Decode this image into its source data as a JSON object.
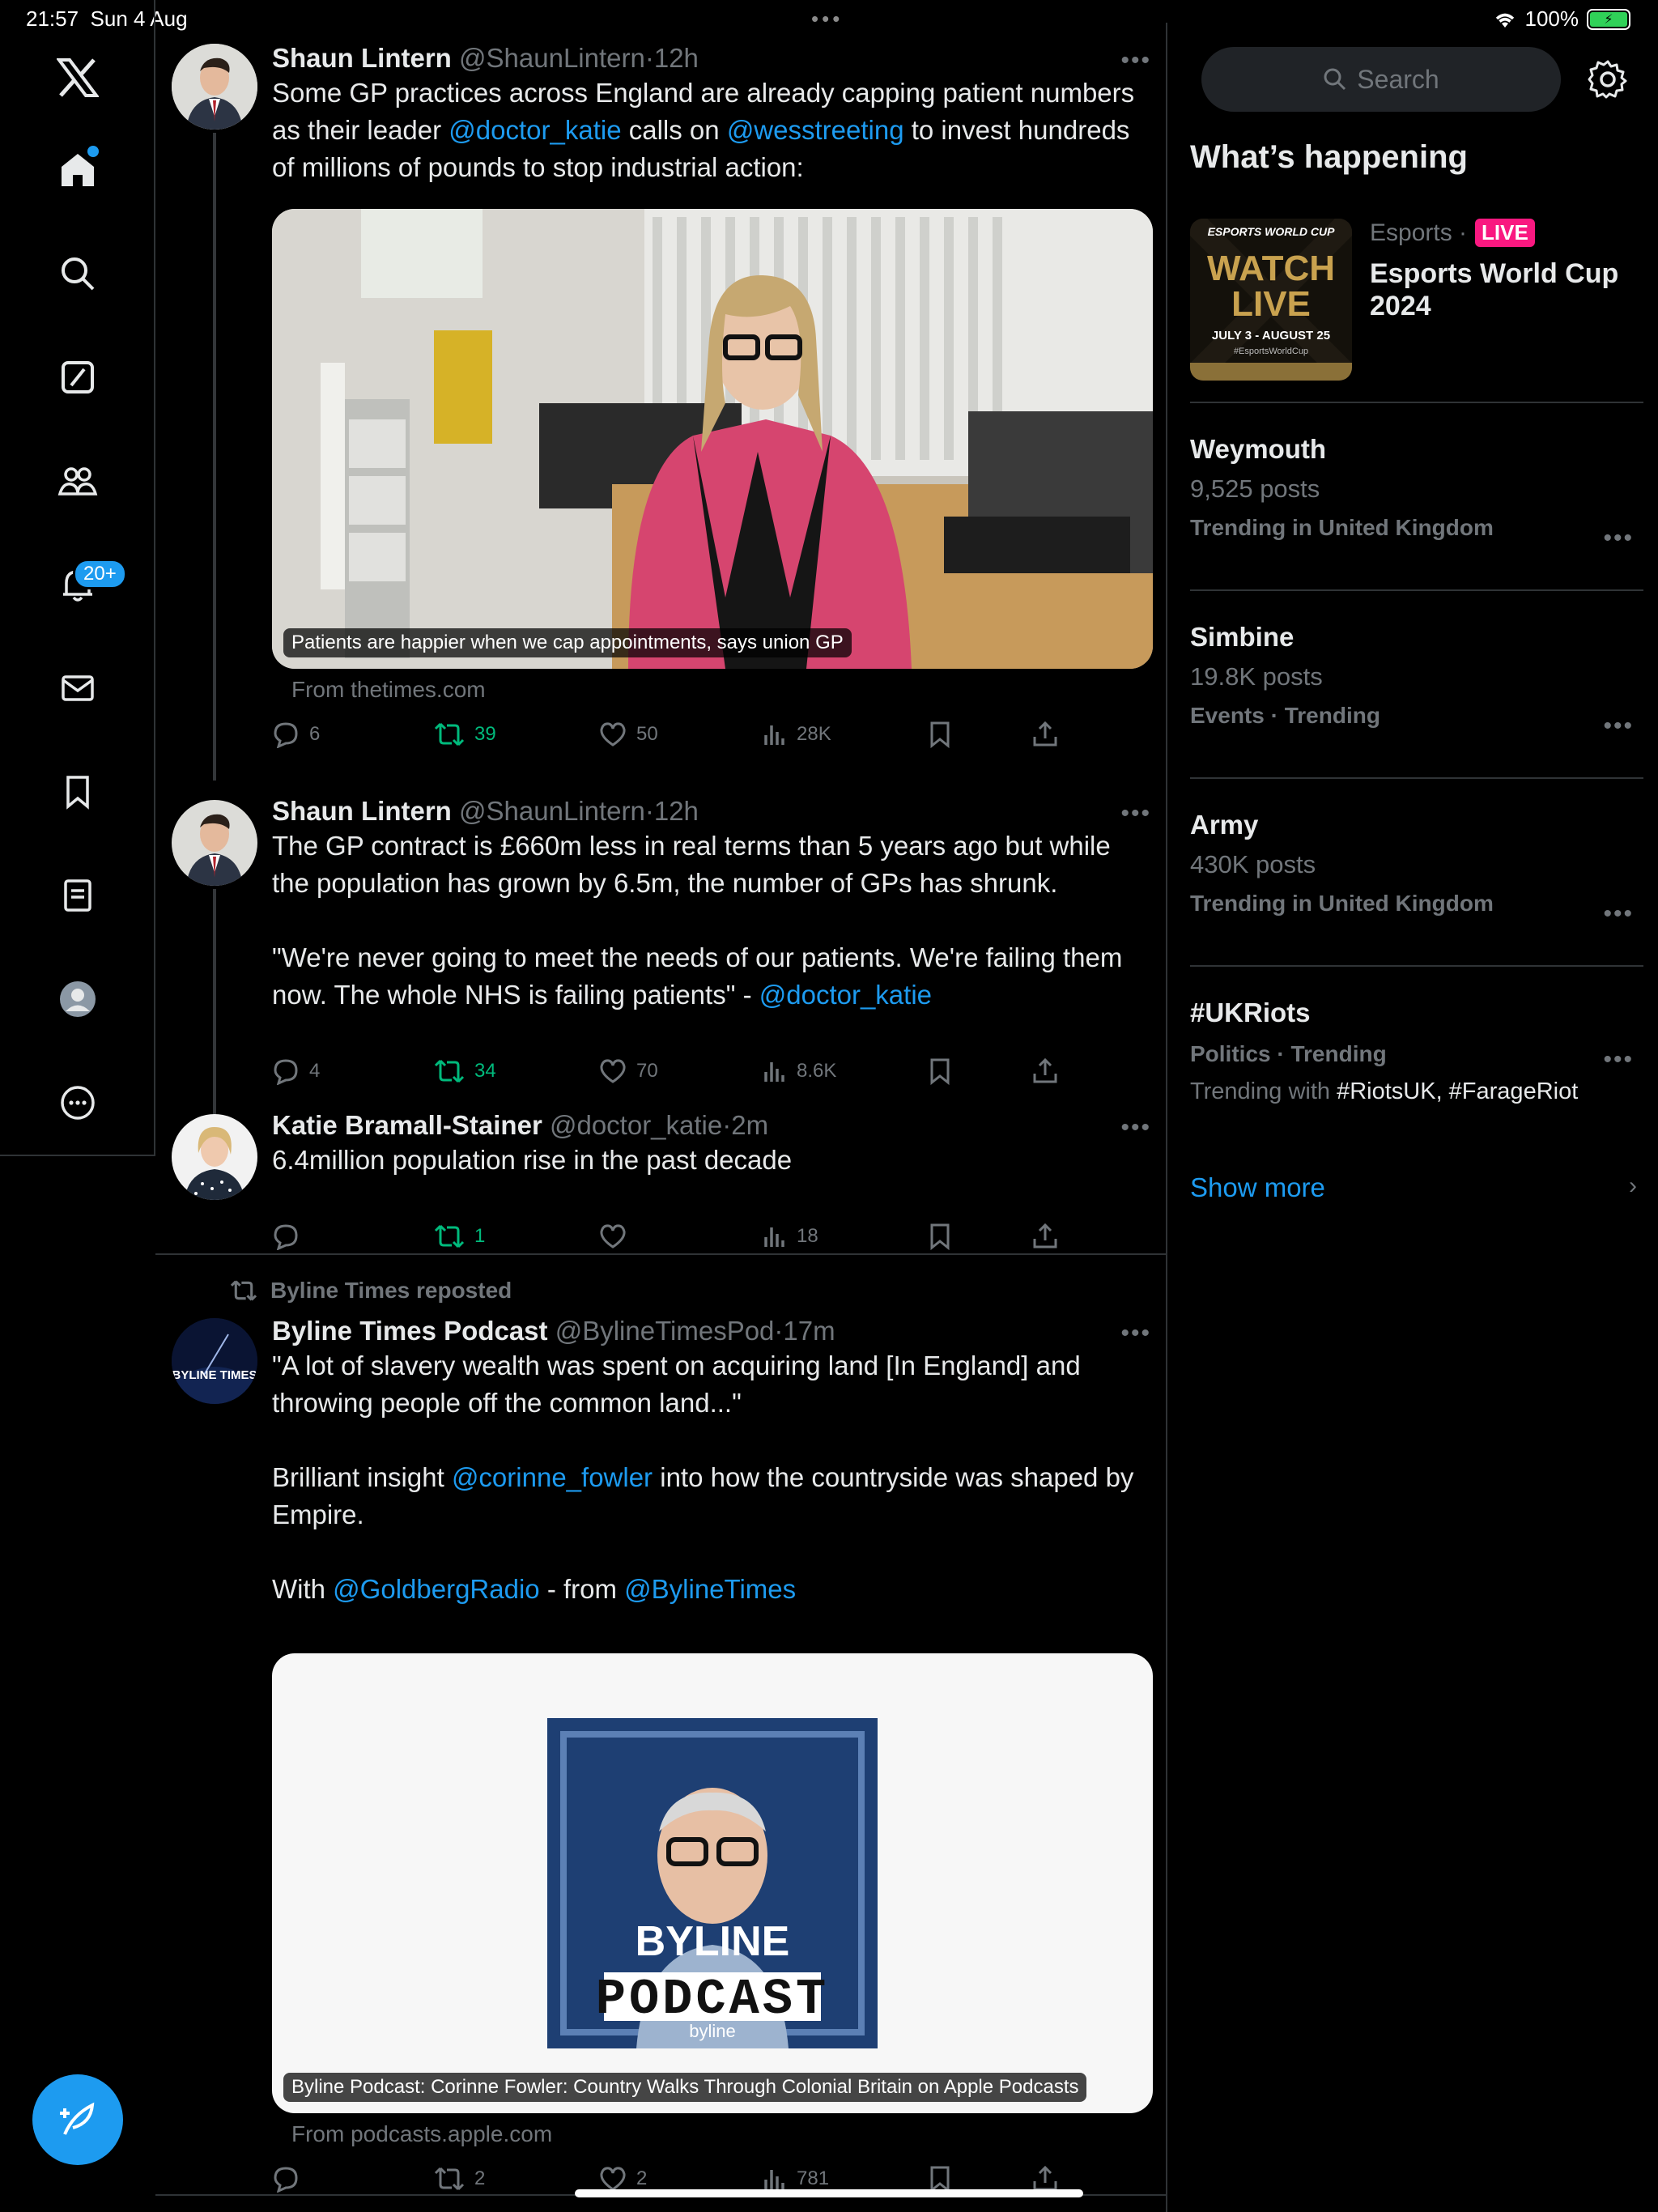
{
  "status_bar": {
    "time": "21:57",
    "date": "Sun 4 Aug",
    "battery": "100%"
  },
  "nav": {
    "notifications_badge": "20+",
    "items": [
      "x-logo-icon",
      "home-icon",
      "search-icon",
      "grok-icon",
      "communities-icon",
      "notifications-icon",
      "messages-icon",
      "bookmarks-icon",
      "lists-icon",
      "profile-icon",
      "more-icon"
    ]
  },
  "tweets": [
    {
      "name": "Shaun Lintern",
      "handle": "@ShaunLintern",
      "sep": "·",
      "time": "12h",
      "text_parts": [
        "Some GP practices across England are already capping patient numbers as their leader ",
        "@doctor_katie",
        " calls on ",
        "@wesstreeting",
        " to invest hundreds of millions of pounds to stop industrial action:"
      ],
      "card_caption": "Patients are happier when we cap appointments, says union GP",
      "card_from": "From thetimes.com",
      "replies": "6",
      "reposts": "39",
      "likes": "50",
      "views": "28K"
    },
    {
      "name": "Shaun Lintern",
      "handle": "@ShaunLintern",
      "sep": "·",
      "time": "12h",
      "text_parts": [
        "The GP contract is £660m less in real terms than 5 years ago but while the population has grown by 6.5m, the number of GPs has shrunk.\n\n\"We're never going to meet the needs of our patients. We're failing them now. The whole NHS is failing patients\" - ",
        "@doctor_katie"
      ],
      "replies": "4",
      "reposts": "34",
      "likes": "70",
      "views": "8.6K"
    },
    {
      "name": "Katie Bramall-Stainer",
      "handle": "@doctor_katie",
      "sep": "·",
      "time": "2m",
      "text": "6.4million population rise in the past decade",
      "replies": "",
      "reposts": "1",
      "likes": "",
      "views": "18"
    },
    {
      "reposted_by": "Byline Times reposted",
      "name": "Byline Times Podcast",
      "handle": "@BylineTimesPod",
      "sep": "·",
      "time": "17m",
      "text_parts": [
        "\"A lot of slavery wealth was spent on acquiring land [In England] and throwing people off the common land...\"\n\nBrilliant insight ",
        "@corinne_fowler",
        " into how the countryside was shaped by Empire.\n\nWith ",
        "@GoldbergRadio",
        " - from ",
        "@BylineTimes"
      ],
      "avatar_text": "BYLINE TIMES",
      "cover_title_1": "BYLINE",
      "cover_title_2": "PODCAST",
      "cover_brand": "byline",
      "card_caption": "Byline Podcast: Corinne Fowler: Country Walks Through Colonial Britain on Apple Podcasts",
      "card_from": "From podcasts.apple.com",
      "replies": "",
      "reposts": "2",
      "likes": "2",
      "views": "781"
    }
  ],
  "sidebar": {
    "search_placeholder": "Search",
    "title": "What’s happening",
    "esports": {
      "category": "Esports ·",
      "live": "LIVE",
      "title": "Esports World Cup 2024",
      "img_top": "ESPORTS WORLD CUP",
      "img_main1": "WATCH",
      "img_main2": "LIVE",
      "img_dates": "JULY 3 - AUGUST 25",
      "img_tag": "#EsportsWorldCup"
    },
    "trends": [
      {
        "name": "Weymouth",
        "posts": "9,525 posts",
        "context": "Trending in United Kingdom"
      },
      {
        "name": "Simbine",
        "posts": "19.8K posts",
        "context": "Events · Trending"
      },
      {
        "name": "Army",
        "posts": "430K posts",
        "context": "Trending in United Kingdom"
      },
      {
        "name": "#UKRiots",
        "context": "Politics · Trending",
        "with_prefix": "Trending with ",
        "with_tags": "#RiotsUK, #FarageRiot"
      }
    ],
    "show_more": "Show more"
  },
  "colors": {
    "accent": "#1d9bf0",
    "repost_green": "#00ba7c",
    "live_pink": "#f91880",
    "background": "#000000"
  }
}
